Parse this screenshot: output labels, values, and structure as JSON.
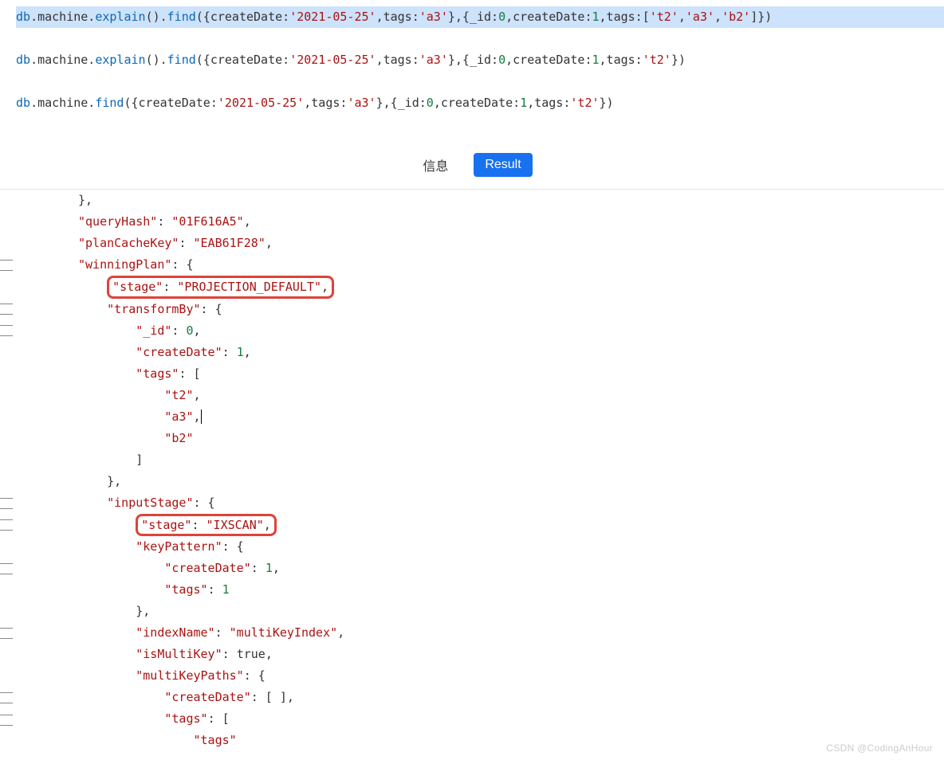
{
  "editor": {
    "lines": [
      {
        "selected": true,
        "tokens": [
          {
            "cls": "k-db",
            "t": "db"
          },
          {
            "cls": "k-plain",
            "t": ".machine."
          },
          {
            "cls": "k-method",
            "t": "explain"
          },
          {
            "cls": "k-plain",
            "t": "()."
          },
          {
            "cls": "k-method",
            "t": "find"
          },
          {
            "cls": "k-plain",
            "t": "({createDate:"
          },
          {
            "cls": "k-str",
            "t": "'2021-05-25'"
          },
          {
            "cls": "k-plain",
            "t": ",tags:"
          },
          {
            "cls": "k-str",
            "t": "'a3'"
          },
          {
            "cls": "k-plain",
            "t": "},{_id:"
          },
          {
            "cls": "k-num",
            "t": "0"
          },
          {
            "cls": "k-plain",
            "t": ",createDate:"
          },
          {
            "cls": "k-num",
            "t": "1"
          },
          {
            "cls": "k-plain",
            "t": ",tags:["
          },
          {
            "cls": "k-str",
            "t": "'t2'"
          },
          {
            "cls": "k-plain",
            "t": ","
          },
          {
            "cls": "k-str",
            "t": "'a3'"
          },
          {
            "cls": "k-plain",
            "t": ","
          },
          {
            "cls": "k-str",
            "t": "'b2'"
          },
          {
            "cls": "k-plain",
            "t": "]})"
          }
        ]
      },
      {
        "blank": true
      },
      {
        "tokens": [
          {
            "cls": "k-db",
            "t": "db"
          },
          {
            "cls": "k-plain",
            "t": ".machine."
          },
          {
            "cls": "k-method",
            "t": "explain"
          },
          {
            "cls": "k-plain",
            "t": "()."
          },
          {
            "cls": "k-method",
            "t": "find"
          },
          {
            "cls": "k-plain",
            "t": "({createDate:"
          },
          {
            "cls": "k-str",
            "t": "'2021-05-25'"
          },
          {
            "cls": "k-plain",
            "t": ",tags:"
          },
          {
            "cls": "k-str",
            "t": "'a3'"
          },
          {
            "cls": "k-plain",
            "t": "},{_id:"
          },
          {
            "cls": "k-num",
            "t": "0"
          },
          {
            "cls": "k-plain",
            "t": ",createDate:"
          },
          {
            "cls": "k-num",
            "t": "1"
          },
          {
            "cls": "k-plain",
            "t": ",tags:"
          },
          {
            "cls": "k-str",
            "t": "'t2'"
          },
          {
            "cls": "k-plain",
            "t": "})"
          }
        ]
      },
      {
        "blank": true
      },
      {
        "tokens": [
          {
            "cls": "k-db",
            "t": "db"
          },
          {
            "cls": "k-plain",
            "t": ".machine."
          },
          {
            "cls": "k-method",
            "t": "find"
          },
          {
            "cls": "k-plain",
            "t": "({createDate:"
          },
          {
            "cls": "k-str",
            "t": "'2021-05-25'"
          },
          {
            "cls": "k-plain",
            "t": ",tags:"
          },
          {
            "cls": "k-str",
            "t": "'a3'"
          },
          {
            "cls": "k-plain",
            "t": "},{_id:"
          },
          {
            "cls": "k-num",
            "t": "0"
          },
          {
            "cls": "k-plain",
            "t": ",createDate:"
          },
          {
            "cls": "k-num",
            "t": "1"
          },
          {
            "cls": "k-plain",
            "t": ",tags:"
          },
          {
            "cls": "k-str",
            "t": "'t2'"
          },
          {
            "cls": "k-plain",
            "t": "})"
          }
        ]
      }
    ]
  },
  "tabs": {
    "info": "信息",
    "result": "Result"
  },
  "result": {
    "lines": [
      {
        "indent": 0,
        "tokens": [
          {
            "cls": "j-punc",
            "t": "},"
          }
        ]
      },
      {
        "indent": 0,
        "tokens": [
          {
            "cls": "j-key",
            "t": "\"queryHash\""
          },
          {
            "cls": "j-punc",
            "t": ": "
          },
          {
            "cls": "j-str",
            "t": "\"01F616A5\""
          },
          {
            "cls": "j-punc",
            "t": ","
          }
        ]
      },
      {
        "indent": 0,
        "tokens": [
          {
            "cls": "j-key",
            "t": "\"planCacheKey\""
          },
          {
            "cls": "j-punc",
            "t": ": "
          },
          {
            "cls": "j-str",
            "t": "\"EAB61F28\""
          },
          {
            "cls": "j-punc",
            "t": ","
          }
        ]
      },
      {
        "indent": 0,
        "tokens": [
          {
            "cls": "j-key",
            "t": "\"winningPlan\""
          },
          {
            "cls": "j-punc",
            "t": ": {"
          }
        ]
      },
      {
        "indent": 1,
        "hl": true,
        "tokens": [
          {
            "cls": "j-key",
            "t": "\"stage\""
          },
          {
            "cls": "j-punc",
            "t": ": "
          },
          {
            "cls": "j-str",
            "t": "\"PROJECTION_DEFAULT\""
          },
          {
            "cls": "j-punc",
            "t": ","
          }
        ]
      },
      {
        "indent": 1,
        "tokens": [
          {
            "cls": "j-key",
            "t": "\"transformBy\""
          },
          {
            "cls": "j-punc",
            "t": ": {"
          }
        ]
      },
      {
        "indent": 2,
        "tokens": [
          {
            "cls": "j-key",
            "t": "\"_id\""
          },
          {
            "cls": "j-punc",
            "t": ": "
          },
          {
            "cls": "j-num",
            "t": "0"
          },
          {
            "cls": "j-punc",
            "t": ","
          }
        ]
      },
      {
        "indent": 2,
        "tokens": [
          {
            "cls": "j-key",
            "t": "\"createDate\""
          },
          {
            "cls": "j-punc",
            "t": ": "
          },
          {
            "cls": "j-num",
            "t": "1"
          },
          {
            "cls": "j-punc",
            "t": ","
          }
        ]
      },
      {
        "indent": 2,
        "tokens": [
          {
            "cls": "j-key",
            "t": "\"tags\""
          },
          {
            "cls": "j-punc",
            "t": ": ["
          }
        ]
      },
      {
        "indent": 3,
        "tokens": [
          {
            "cls": "j-str",
            "t": "\"t2\""
          },
          {
            "cls": "j-punc",
            "t": ","
          }
        ]
      },
      {
        "indent": 3,
        "cursor": true,
        "tokens": [
          {
            "cls": "j-str",
            "t": "\"a3\""
          },
          {
            "cls": "j-punc",
            "t": ","
          }
        ]
      },
      {
        "indent": 3,
        "tokens": [
          {
            "cls": "j-str",
            "t": "\"b2\""
          }
        ]
      },
      {
        "indent": 2,
        "tokens": [
          {
            "cls": "j-punc",
            "t": "]"
          }
        ]
      },
      {
        "indent": 1,
        "tokens": [
          {
            "cls": "j-punc",
            "t": "},"
          }
        ]
      },
      {
        "indent": 1,
        "tokens": [
          {
            "cls": "j-key",
            "t": "\"inputStage\""
          },
          {
            "cls": "j-punc",
            "t": ": {"
          }
        ]
      },
      {
        "indent": 2,
        "hl": true,
        "tokens": [
          {
            "cls": "j-key",
            "t": "\"stage\""
          },
          {
            "cls": "j-punc",
            "t": ": "
          },
          {
            "cls": "j-str",
            "t": "\"IXSCAN\""
          },
          {
            "cls": "j-punc",
            "t": ","
          }
        ]
      },
      {
        "indent": 2,
        "tokens": [
          {
            "cls": "j-key",
            "t": "\"keyPattern\""
          },
          {
            "cls": "j-punc",
            "t": ": {"
          }
        ]
      },
      {
        "indent": 3,
        "tokens": [
          {
            "cls": "j-key",
            "t": "\"createDate\""
          },
          {
            "cls": "j-punc",
            "t": ": "
          },
          {
            "cls": "j-num",
            "t": "1"
          },
          {
            "cls": "j-punc",
            "t": ","
          }
        ]
      },
      {
        "indent": 3,
        "tokens": [
          {
            "cls": "j-key",
            "t": "\"tags\""
          },
          {
            "cls": "j-punc",
            "t": ": "
          },
          {
            "cls": "j-num",
            "t": "1"
          }
        ]
      },
      {
        "indent": 2,
        "tokens": [
          {
            "cls": "j-punc",
            "t": "},"
          }
        ]
      },
      {
        "indent": 2,
        "tokens": [
          {
            "cls": "j-key",
            "t": "\"indexName\""
          },
          {
            "cls": "j-punc",
            "t": ": "
          },
          {
            "cls": "j-str",
            "t": "\"multiKeyIndex\""
          },
          {
            "cls": "j-punc",
            "t": ","
          }
        ]
      },
      {
        "indent": 2,
        "tokens": [
          {
            "cls": "j-key",
            "t": "\"isMultiKey\""
          },
          {
            "cls": "j-punc",
            "t": ": "
          },
          {
            "cls": "j-bool",
            "t": "true"
          },
          {
            "cls": "j-punc",
            "t": ","
          }
        ]
      },
      {
        "indent": 2,
        "tokens": [
          {
            "cls": "j-key",
            "t": "\"multiKeyPaths\""
          },
          {
            "cls": "j-punc",
            "t": ": {"
          }
        ]
      },
      {
        "indent": 3,
        "tokens": [
          {
            "cls": "j-key",
            "t": "\"createDate\""
          },
          {
            "cls": "j-punc",
            "t": ": [ ],"
          }
        ]
      },
      {
        "indent": 3,
        "tokens": [
          {
            "cls": "j-key",
            "t": "\"tags\""
          },
          {
            "cls": "j-punc",
            "t": ": ["
          }
        ]
      },
      {
        "indent": 4,
        "tokens": [
          {
            "cls": "j-str",
            "t": "\"tags\""
          }
        ]
      }
    ],
    "gutter_ticks": [
      3,
      5,
      6,
      14,
      15,
      17,
      20,
      23,
      24
    ]
  },
  "watermark": "CSDN @CodingAnHour"
}
